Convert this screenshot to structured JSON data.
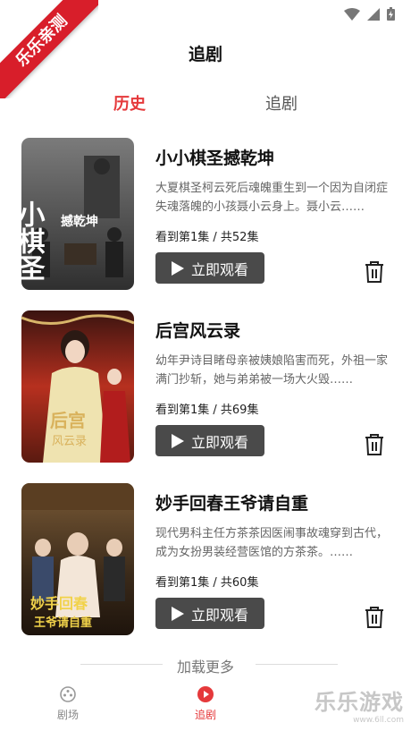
{
  "ribbon": {
    "text": "乐乐亲测"
  },
  "header": {
    "title": "追剧"
  },
  "tabs": [
    {
      "label": "历史",
      "active": true
    },
    {
      "label": "追剧",
      "active": false
    }
  ],
  "dramas": [
    {
      "title": "小小棋圣撼乾坤",
      "description": "大夏棋圣柯云死后魂魄重生到一个因为自闭症失魂落魄的小孩聂小云身上。聂小云……",
      "progress": "看到第1集 / 共52集",
      "button_label": "立即观看",
      "poster_text": "小棋圣",
      "poster_subtext": "撼乾坤"
    },
    {
      "title": "后宫风云录",
      "description": "幼年尹诗目睹母亲被姨娘陷害而死，外祖一家满门抄斩，她与弟弟被一场大火毁……",
      "progress": "看到第1集 / 共69集",
      "button_label": "立即观看",
      "poster_text": "后宫",
      "poster_subtext": "风云录"
    },
    {
      "title": "妙手回春王爷请自重",
      "description": "现代男科主任方茶茶因医闹事故魂穿到古代，成为女扮男装经营医馆的方茶茶。……",
      "progress": "看到第1集 / 共60集",
      "button_label": "立即观看",
      "poster_text": "妙手回春",
      "poster_subtext": "王爷请自重"
    }
  ],
  "load_more": "加载更多",
  "bottom_nav": [
    {
      "label": "剧场",
      "icon": "theater-icon",
      "active": false
    },
    {
      "label": "追剧",
      "icon": "play-circle-icon",
      "active": true
    }
  ],
  "watermark": {
    "main": "乐乐游戏",
    "url": "www.6ll.com"
  },
  "colors": {
    "accent": "#e5393b",
    "button_bg": "#4a4a4a",
    "ribbon": "#d81e2a"
  }
}
